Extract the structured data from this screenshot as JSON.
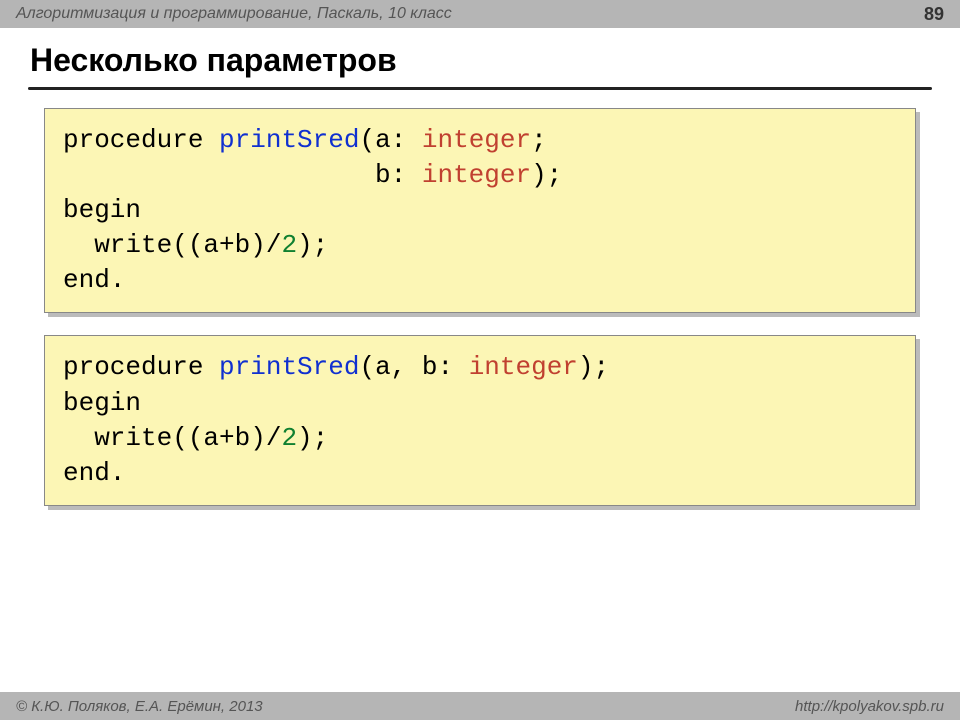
{
  "header": {
    "subject": "Алгоритмизация и программирование, Паскаль, 10 класс",
    "page_number": "89"
  },
  "title": "Несколько параметров",
  "code1": {
    "l1_kw": "procedure ",
    "l1_name": "printSred",
    "l1_rest": "(a: ",
    "l1_type": "integer",
    "l1_close": ";",
    "l2_indent": "                    b: ",
    "l2_type": "integer",
    "l2_close": ");",
    "l3": "begin",
    "l4_pre": "  write((a+b)/",
    "l4_num": "2",
    "l4_post": ");",
    "l5": "end."
  },
  "code2": {
    "l1_kw": "procedure ",
    "l1_name": "printSred",
    "l1_rest": "(a, b: ",
    "l1_type": "integer",
    "l1_close": ");",
    "l2": "begin",
    "l3_pre": "  write((a+b)/",
    "l3_num": "2",
    "l3_post": ");",
    "l4": "end."
  },
  "footer": {
    "copyright": "© К.Ю. Поляков, Е.А. Ерёмин, 2013",
    "url": "http://kpolyakov.spb.ru"
  }
}
